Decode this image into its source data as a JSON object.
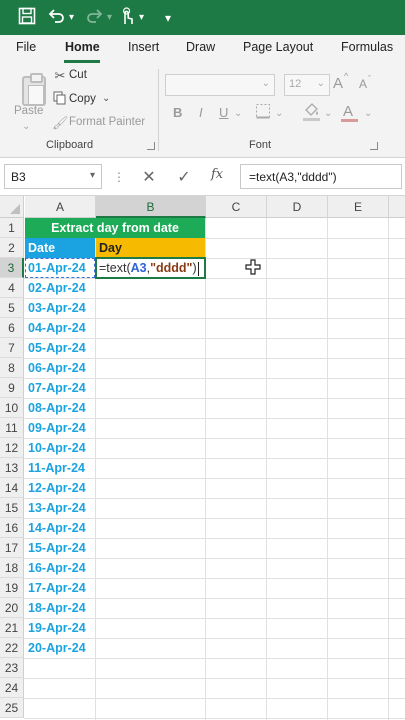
{
  "colors": {
    "title_bar": "#1d7a45",
    "title_cell_bg": "#1eab57",
    "date_header_bg": "#1aa3e0",
    "day_header_bg": "#f6bb00",
    "date_text": "#1aa3e0",
    "selection": "#1d7a45",
    "ref_highlight": "#2f64d6",
    "string_literal": "#8b3a14"
  },
  "titlebar": {
    "icons": [
      "save-icon",
      "undo-icon",
      "redo-icon",
      "touch-mode-icon",
      "customize-toolbar-icon"
    ]
  },
  "tabs": [
    "File",
    "Home",
    "Insert",
    "Draw",
    "Page Layout",
    "Formulas"
  ],
  "active_tab": "Home",
  "ribbon": {
    "clipboard": {
      "paste_label": "Paste",
      "cut_label": "Cut",
      "copy_label": "Copy",
      "format_painter_label": "Format Painter",
      "group_label": "Clipboard"
    },
    "font": {
      "font_size_value": "12",
      "bold_label": "B",
      "italic_label": "I",
      "underline_label": "U",
      "grow_label": "A",
      "shrink_label": "A",
      "font_color_label": "A",
      "group_label": "Font"
    }
  },
  "formula_bar": {
    "name_box": "B3",
    "cancel_glyph": "✕",
    "enter_glyph": "✓",
    "fx_label": "fx",
    "formula": "=text(A3,\"dddd\")"
  },
  "columns": [
    "A",
    "B",
    "C",
    "D",
    "E"
  ],
  "rows": [
    "1",
    "2",
    "3",
    "4",
    "5",
    "6",
    "7",
    "8",
    "9",
    "10",
    "11",
    "12",
    "13",
    "14",
    "15",
    "16",
    "17",
    "18",
    "19",
    "20",
    "21",
    "22",
    "23",
    "24",
    "25"
  ],
  "selected_cell": {
    "column": "B",
    "row": "3"
  },
  "sheet": {
    "title": "Extract day from date",
    "date_header": "Date",
    "day_header": "Day",
    "dates": [
      "01-Apr-24",
      "02-Apr-24",
      "03-Apr-24",
      "04-Apr-24",
      "05-Apr-24",
      "06-Apr-24",
      "07-Apr-24",
      "08-Apr-24",
      "09-Apr-24",
      "10-Apr-24",
      "11-Apr-24",
      "12-Apr-24",
      "13-Apr-24",
      "14-Apr-24",
      "15-Apr-24",
      "16-Apr-24",
      "17-Apr-24",
      "18-Apr-24",
      "19-Apr-24",
      "20-Apr-24"
    ],
    "editing_formula": {
      "prefix": "=text(",
      "ref": "A3",
      "comma": ",",
      "string": "\"dddd\"",
      "suffix": ")"
    }
  }
}
